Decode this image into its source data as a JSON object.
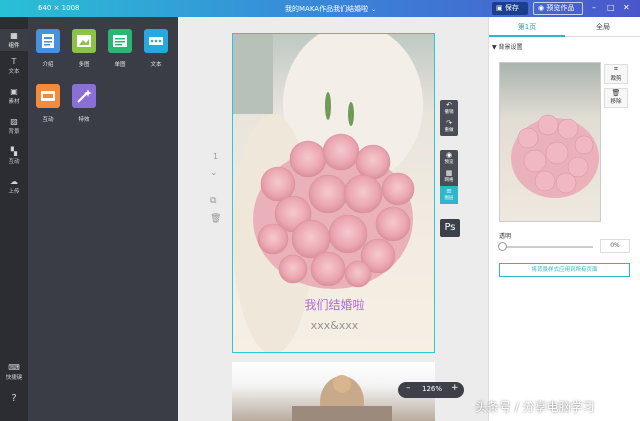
{
  "topbar": {
    "dims": "640 × 1008",
    "title": "我的MAKA作品我们结婚啦",
    "save_label": "保存",
    "preview_label": "预览作品"
  },
  "rail": {
    "items": [
      {
        "label": "组件"
      },
      {
        "label": "文本"
      },
      {
        "label": "素材"
      },
      {
        "label": "背景"
      },
      {
        "label": "互动"
      },
      {
        "label": "上传"
      },
      {
        "label": "快捷键"
      }
    ]
  },
  "panel": {
    "tiles": [
      {
        "label": "介绍",
        "icon": "intro-card-icon",
        "color": "#4a90e2"
      },
      {
        "label": "多图",
        "icon": "multi-image-icon",
        "color": "#8bc34a"
      },
      {
        "label": "单图",
        "icon": "single-image-icon",
        "color": "#2bb673"
      },
      {
        "label": "文本",
        "icon": "text-block-icon",
        "color": "#26a9e0"
      },
      {
        "label": "互动",
        "icon": "interact-icon",
        "color": "#f48a3c"
      },
      {
        "label": "特效",
        "icon": "magic-wand-icon",
        "color": "#8a6fd6"
      }
    ]
  },
  "canvas": {
    "page_number": "1",
    "heading": "我们结婚啦",
    "subheading": "xxx&xxx",
    "zoom": "126%"
  },
  "floating_toolbar": {
    "buttons": [
      {
        "label": "撤销",
        "icon": "undo-icon"
      },
      {
        "label": "重做",
        "icon": "redo-icon"
      },
      {
        "label": "预览",
        "icon": "eye-icon"
      },
      {
        "label": "网格",
        "icon": "grid-icon"
      },
      {
        "label": "图层",
        "icon": "layers-icon"
      }
    ],
    "ps_label": "Ps"
  },
  "props": {
    "tabs": [
      "第1页",
      "全局"
    ],
    "section_title": "▼ 背景设置",
    "crop_label": "裁剪",
    "remove_label": "移除",
    "opacity_label": "透明",
    "opacity_value": "0%",
    "apply_label": "将背景样式应用到所有页面"
  },
  "watermark": "头条号 / 分享电脑学习",
  "colors": {
    "accent": "#2cb6c8",
    "heading_text": "#b06ad6",
    "rail_bg": "#2b2d33",
    "panel_bg": "#3a3d45"
  }
}
